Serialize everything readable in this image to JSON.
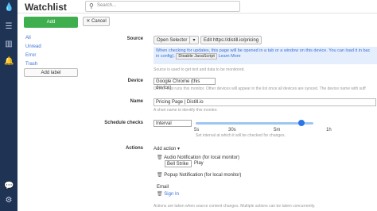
{
  "app": {
    "title": "Watchlist"
  },
  "search": {
    "placeholder": "Search..."
  },
  "nav_icons": [
    "drop-icon",
    "list-icon",
    "chart-icon",
    "bell-icon",
    "chat-icon",
    "gear-icon"
  ],
  "sidebar": {
    "add_label": "Add",
    "filters": [
      "All",
      "Unread",
      "Error",
      "Trash"
    ],
    "add_label_btn": "Add label"
  },
  "toolbar": {
    "cancel": "✕ Cancel"
  },
  "source": {
    "label": "Source",
    "open_selector": "Open Selector",
    "url_button": "Edit https://distill.io/pricing",
    "info": "When checking for updates, this page will be opened in a tab or a window on this device. You can load it in bac in config).",
    "info_kbd": "Disable JavaScript",
    "info_link": "Learn More",
    "hint": "Source is used to get text and data to be monitored."
  },
  "device": {
    "label": "Device",
    "value": "Google Chrome (this device)",
    "hint": "Device that runs this monitor. Other devices will appear in the list once all devices are synced. The device name with suff"
  },
  "name": {
    "label": "Name",
    "value": "Pricing Page | Distill.io",
    "hint": "A short name to identify this monitor."
  },
  "schedule": {
    "label": "Schedule checks",
    "mode": "Interval",
    "ticks": [
      "5s",
      "30s",
      "5m",
      "1h"
    ],
    "level": 0.9,
    "hint": "Set interval at which it will be checked for changes."
  },
  "actions": {
    "label": "Actions",
    "add_action": "Add action ▾",
    "items": [
      {
        "title": "Audio Notification (for local monitor)",
        "sound": "Bell Strike",
        "play": "Play"
      },
      {
        "title": "Popup Notification (for local monitor)"
      }
    ],
    "email_label": "Email",
    "sign_in": "Sign In",
    "hint": "Actions are taken when source content changes. Multiple actions can be taken concurrently."
  }
}
